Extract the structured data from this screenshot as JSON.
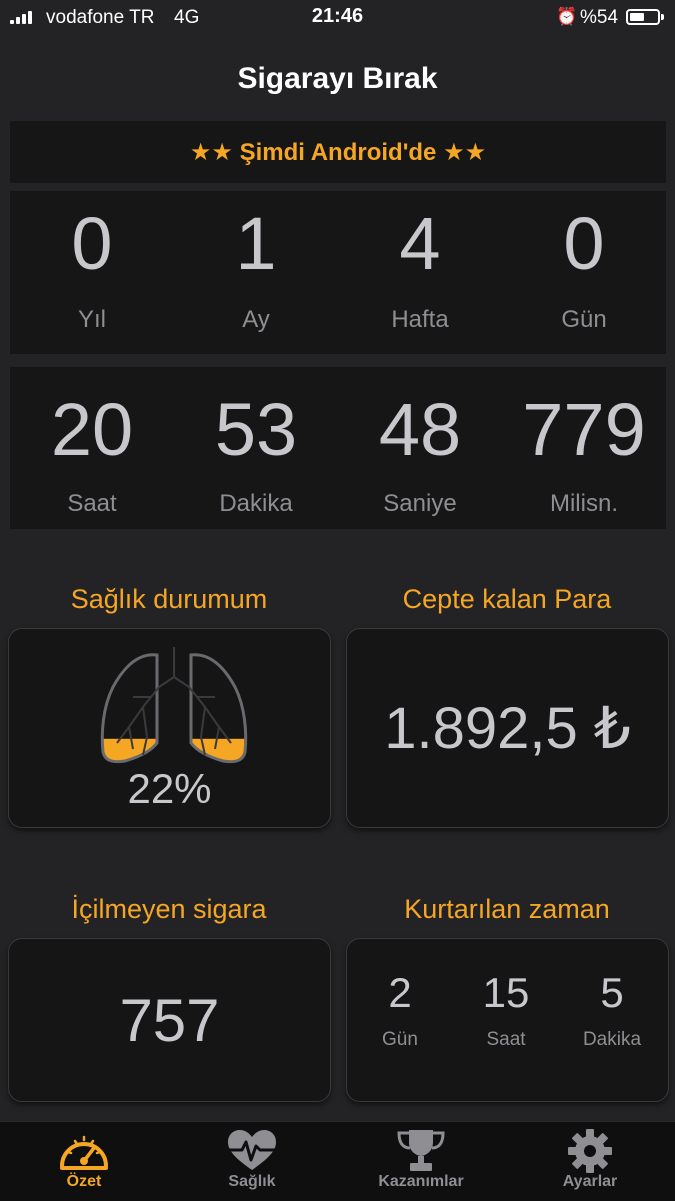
{
  "status_bar": {
    "carrier": "vodafone TR",
    "network": "4G",
    "time": "21:46",
    "alarm_icon": "alarm-clock-icon",
    "battery": "%54",
    "battery_level": 0.54
  },
  "header": {
    "title": "Sigarayı Bırak"
  },
  "promo": {
    "text": "★★ Şimdi Android'de ★★"
  },
  "elapsed": {
    "row1": [
      {
        "value": "0",
        "label": "Yıl"
      },
      {
        "value": "1",
        "label": "Ay"
      },
      {
        "value": "4",
        "label": "Hafta"
      },
      {
        "value": "0",
        "label": "Gün"
      }
    ],
    "row2": [
      {
        "value": "20",
        "label": "Saat"
      },
      {
        "value": "53",
        "label": "Dakika"
      },
      {
        "value": "48",
        "label": "Saniye"
      },
      {
        "value": "779",
        "label": "Milisn."
      }
    ]
  },
  "health": {
    "heading": "Sağlık durumum",
    "percent": "22%",
    "fill_level": 0.22
  },
  "money": {
    "heading": "Cepte kalan Para",
    "value": "1.892,5 ₺"
  },
  "cigarettes": {
    "heading": "İçilmeyen sigara",
    "value": "757"
  },
  "time_saved": {
    "heading": "Kurtarılan zaman",
    "items": [
      {
        "value": "2",
        "label": "Gün"
      },
      {
        "value": "15",
        "label": "Saat"
      },
      {
        "value": "5",
        "label": "Dakika"
      }
    ]
  },
  "tabs": [
    {
      "label": "Özet",
      "icon": "speedometer-icon",
      "active": true
    },
    {
      "label": "Sağlık",
      "icon": "heart-pulse-icon",
      "active": false
    },
    {
      "label": "Kazanımlar",
      "icon": "trophy-icon",
      "active": false
    },
    {
      "label": "Ayarlar",
      "icon": "gear-icon",
      "active": false
    }
  ],
  "colors": {
    "accent": "#f5a623",
    "background": "#232325",
    "panel": "#161617"
  }
}
